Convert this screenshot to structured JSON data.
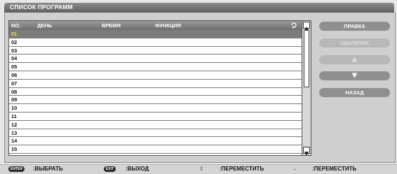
{
  "window": {
    "title": "СПИСОК ПРОГРАММ"
  },
  "list": {
    "columns": {
      "no": "NO.",
      "day": "ДЕНЬ",
      "time": "ВРЕМЯ",
      "function": "ФУНКЦИЯ"
    },
    "repeat_column_icon": "repeat-icon",
    "selected_index": 0,
    "rows": [
      "01",
      "02",
      "03",
      "04",
      "05",
      "06",
      "07",
      "08",
      "09",
      "10",
      "11",
      "12",
      "13",
      "14",
      "15"
    ]
  },
  "buttons": {
    "edit": "ПРАВКА",
    "delete": "УДАЛЕНИЕ",
    "move_up_icon": "triangle-up",
    "move_down_icon": "triangle-down",
    "back": "НАЗАД"
  },
  "footer": {
    "enter_key": "ENTER",
    "select_label": ":ВЫБРАТЬ",
    "exit_key": "EXIT",
    "exit_label": ":ВЫХОД",
    "updown_glyph": "⇕",
    "move_label_1": ":ПЕРЕМЕСТИТЬ",
    "leftright_glyph": "↔",
    "move_label_2": ":ПЕРЕМЕСТИТЬ"
  },
  "colors": {
    "selected_row": "#7c7c7c",
    "selected_text": "#f2e60a",
    "button": "#8f8f8f"
  }
}
